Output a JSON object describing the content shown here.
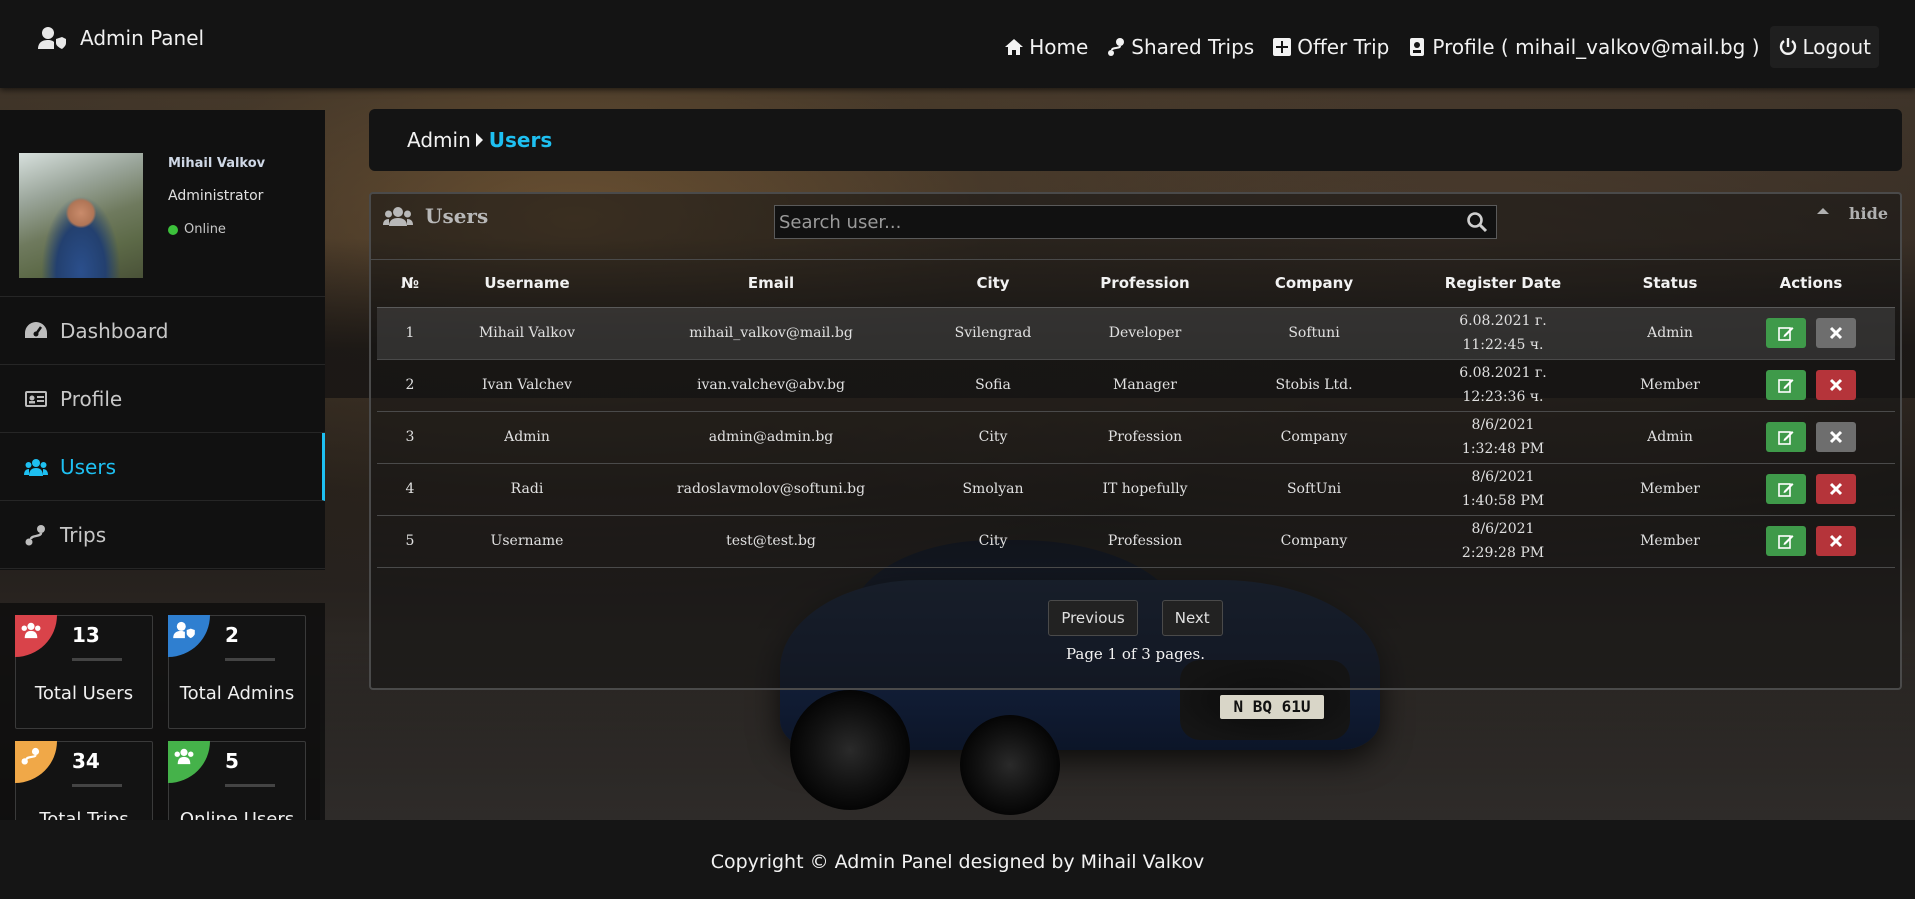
{
  "brand": {
    "title": "Admin Panel"
  },
  "nav": {
    "home": "Home",
    "shared_trips": "Shared Trips",
    "offer_trip": "Offer Trip",
    "profile": "Profile ( mihail_valkov@mail.bg )",
    "logout": "Logout"
  },
  "user": {
    "name": "Mihail Valkov",
    "role": "Administrator",
    "status": "Online"
  },
  "sidebar": {
    "items": [
      {
        "label": "Dashboard",
        "icon": "dashboard-icon"
      },
      {
        "label": "Profile",
        "icon": "id-card-icon"
      },
      {
        "label": "Users",
        "icon": "users-icon",
        "active": true
      },
      {
        "label": "Trips",
        "icon": "route-icon"
      }
    ]
  },
  "stats": [
    {
      "value": "13",
      "label": "Total Users",
      "color": "#d9434a"
    },
    {
      "value": "2",
      "label": "Total Admins",
      "color": "#2f7fd0"
    },
    {
      "value": "34",
      "label": "Total Trips",
      "color": "#f0a848"
    },
    {
      "value": "5",
      "label": "Online Users",
      "color": "#45b24a"
    }
  ],
  "breadcrumb": {
    "parent": "Admin",
    "current": "Users"
  },
  "panel": {
    "title": "Users",
    "search_placeholder": "Search user...",
    "hide_label": "hide",
    "columns": [
      "№",
      "Username",
      "Email",
      "City",
      "Profession",
      "Company",
      "Register Date",
      "Status",
      "Actions"
    ],
    "rows": [
      {
        "no": "1",
        "username": "Mihail Valkov",
        "email": "mihail_valkov@mail.bg",
        "city": "Svilengrad",
        "profession": "Developer",
        "company": "Softuni",
        "date": "6.08.2021 г.",
        "time": "11:22:45 ч.",
        "status": "Admin"
      },
      {
        "no": "2",
        "username": "Ivan Valchev",
        "email": "ivan.valchev@abv.bg",
        "city": "Sofia",
        "profession": "Manager",
        "company": "Stobis Ltd.",
        "date": "6.08.2021 г.",
        "time": "12:23:36 ч.",
        "status": "Member"
      },
      {
        "no": "3",
        "username": "Admin",
        "email": "admin@admin.bg",
        "city": "City",
        "profession": "Profession",
        "company": "Company",
        "date": "8/6/2021",
        "time": "1:32:48 PM",
        "status": "Admin"
      },
      {
        "no": "4",
        "username": "Radi",
        "email": "radoslavmolov@softuni.bg",
        "city": "Smolyan",
        "profession": "IT hopefully",
        "company": "SoftUni",
        "date": "8/6/2021",
        "time": "1:40:58 PM",
        "status": "Member"
      },
      {
        "no": "5",
        "username": "Username",
        "email": "test@test.bg",
        "city": "City",
        "profession": "Profession",
        "company": "Company",
        "date": "8/6/2021",
        "time": "2:29:28 PM",
        "status": "Member"
      }
    ],
    "pager": {
      "previous": "Previous",
      "next": "Next",
      "info": "Page 1 of 3 pages."
    }
  },
  "car_plate": "N BQ 61U",
  "footer": {
    "text": "Copyright © Admin Panel designed by Mihail Valkov"
  }
}
